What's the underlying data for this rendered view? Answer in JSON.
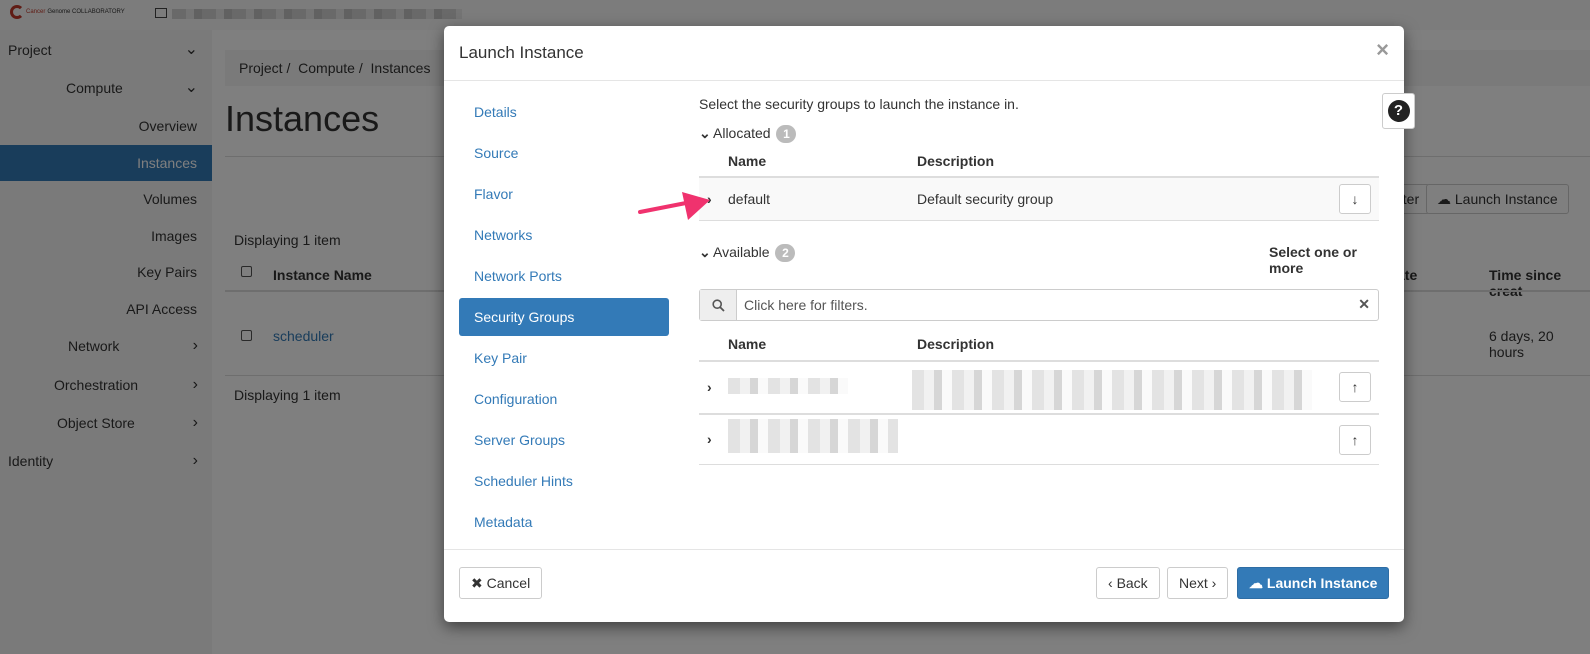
{
  "logo": {
    "text_red": "Cancer",
    "text_rest": "Genome COLLABORATORY"
  },
  "sidebar": {
    "items": [
      {
        "label": "Project"
      },
      {
        "label": "Compute"
      },
      {
        "label": "Overview"
      },
      {
        "label": "Instances"
      },
      {
        "label": "Volumes"
      },
      {
        "label": "Images"
      },
      {
        "label": "Key Pairs"
      },
      {
        "label": "API Access"
      },
      {
        "label": "Network"
      },
      {
        "label": "Orchestration"
      },
      {
        "label": "Object Store"
      },
      {
        "label": "Identity"
      }
    ]
  },
  "page": {
    "breadcrumb": [
      "Project",
      "Compute",
      "Instances"
    ],
    "title": "Instances",
    "displaying_top": "Displaying 1 item",
    "displaying_bottom": "Displaying 1 item",
    "filter_button": "Filter",
    "launch_button": "Launch Instance",
    "columns": {
      "instance_name": "Instance Name",
      "state": "ate",
      "time_since": "Time since creat"
    },
    "row": {
      "name": "scheduler",
      "time_since": "6 days, 20 hours"
    }
  },
  "modal": {
    "title": "Launch Instance",
    "nav": [
      "Details",
      "Source",
      "Flavor",
      "Networks",
      "Network Ports",
      "Security Groups",
      "Key Pair",
      "Configuration",
      "Server Groups",
      "Scheduler Hints",
      "Metadata"
    ],
    "active_nav": "Security Groups",
    "intro": "Select the security groups to launch the instance in.",
    "allocated": {
      "label": "Allocated",
      "count": "1",
      "col_name": "Name",
      "col_description": "Description",
      "rows": [
        {
          "name": "default",
          "description": "Default security group"
        }
      ]
    },
    "available": {
      "label": "Available",
      "count": "2",
      "hint": "Select one or more",
      "filter_placeholder": "Click here for filters.",
      "col_name": "Name",
      "col_description": "Description"
    },
    "footer": {
      "cancel": "Cancel",
      "back": "Back",
      "next": "Next",
      "launch": "Launch Instance"
    }
  },
  "colors": {
    "primary": "#337ab7",
    "annotation_arrow": "#f0326e"
  }
}
